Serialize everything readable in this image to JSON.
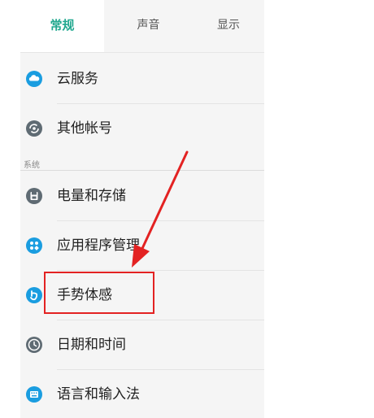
{
  "tabs": [
    {
      "label": "常规",
      "active": true
    },
    {
      "label": "声音",
      "active": false
    },
    {
      "label": "显示",
      "active": false
    }
  ],
  "accounts": [
    {
      "label": "云服务",
      "icon": "cloud-icon"
    },
    {
      "label": "其他帐号",
      "icon": "account-sync-icon"
    }
  ],
  "system": {
    "header": "系统",
    "items": [
      {
        "label": "电量和存储",
        "icon": "storage-icon"
      },
      {
        "label": "应用程序管理",
        "icon": "apps-icon"
      },
      {
        "label": "手势体感",
        "icon": "gesture-icon"
      },
      {
        "label": "日期和时间",
        "icon": "clock-icon"
      },
      {
        "label": "语言和输入法",
        "icon": "keyboard-icon"
      }
    ]
  },
  "colors": {
    "accent": "#21a88f",
    "icon_blue": "#1a9de0",
    "icon_gray": "#5f6b73",
    "annotation_red": "#e32222"
  }
}
